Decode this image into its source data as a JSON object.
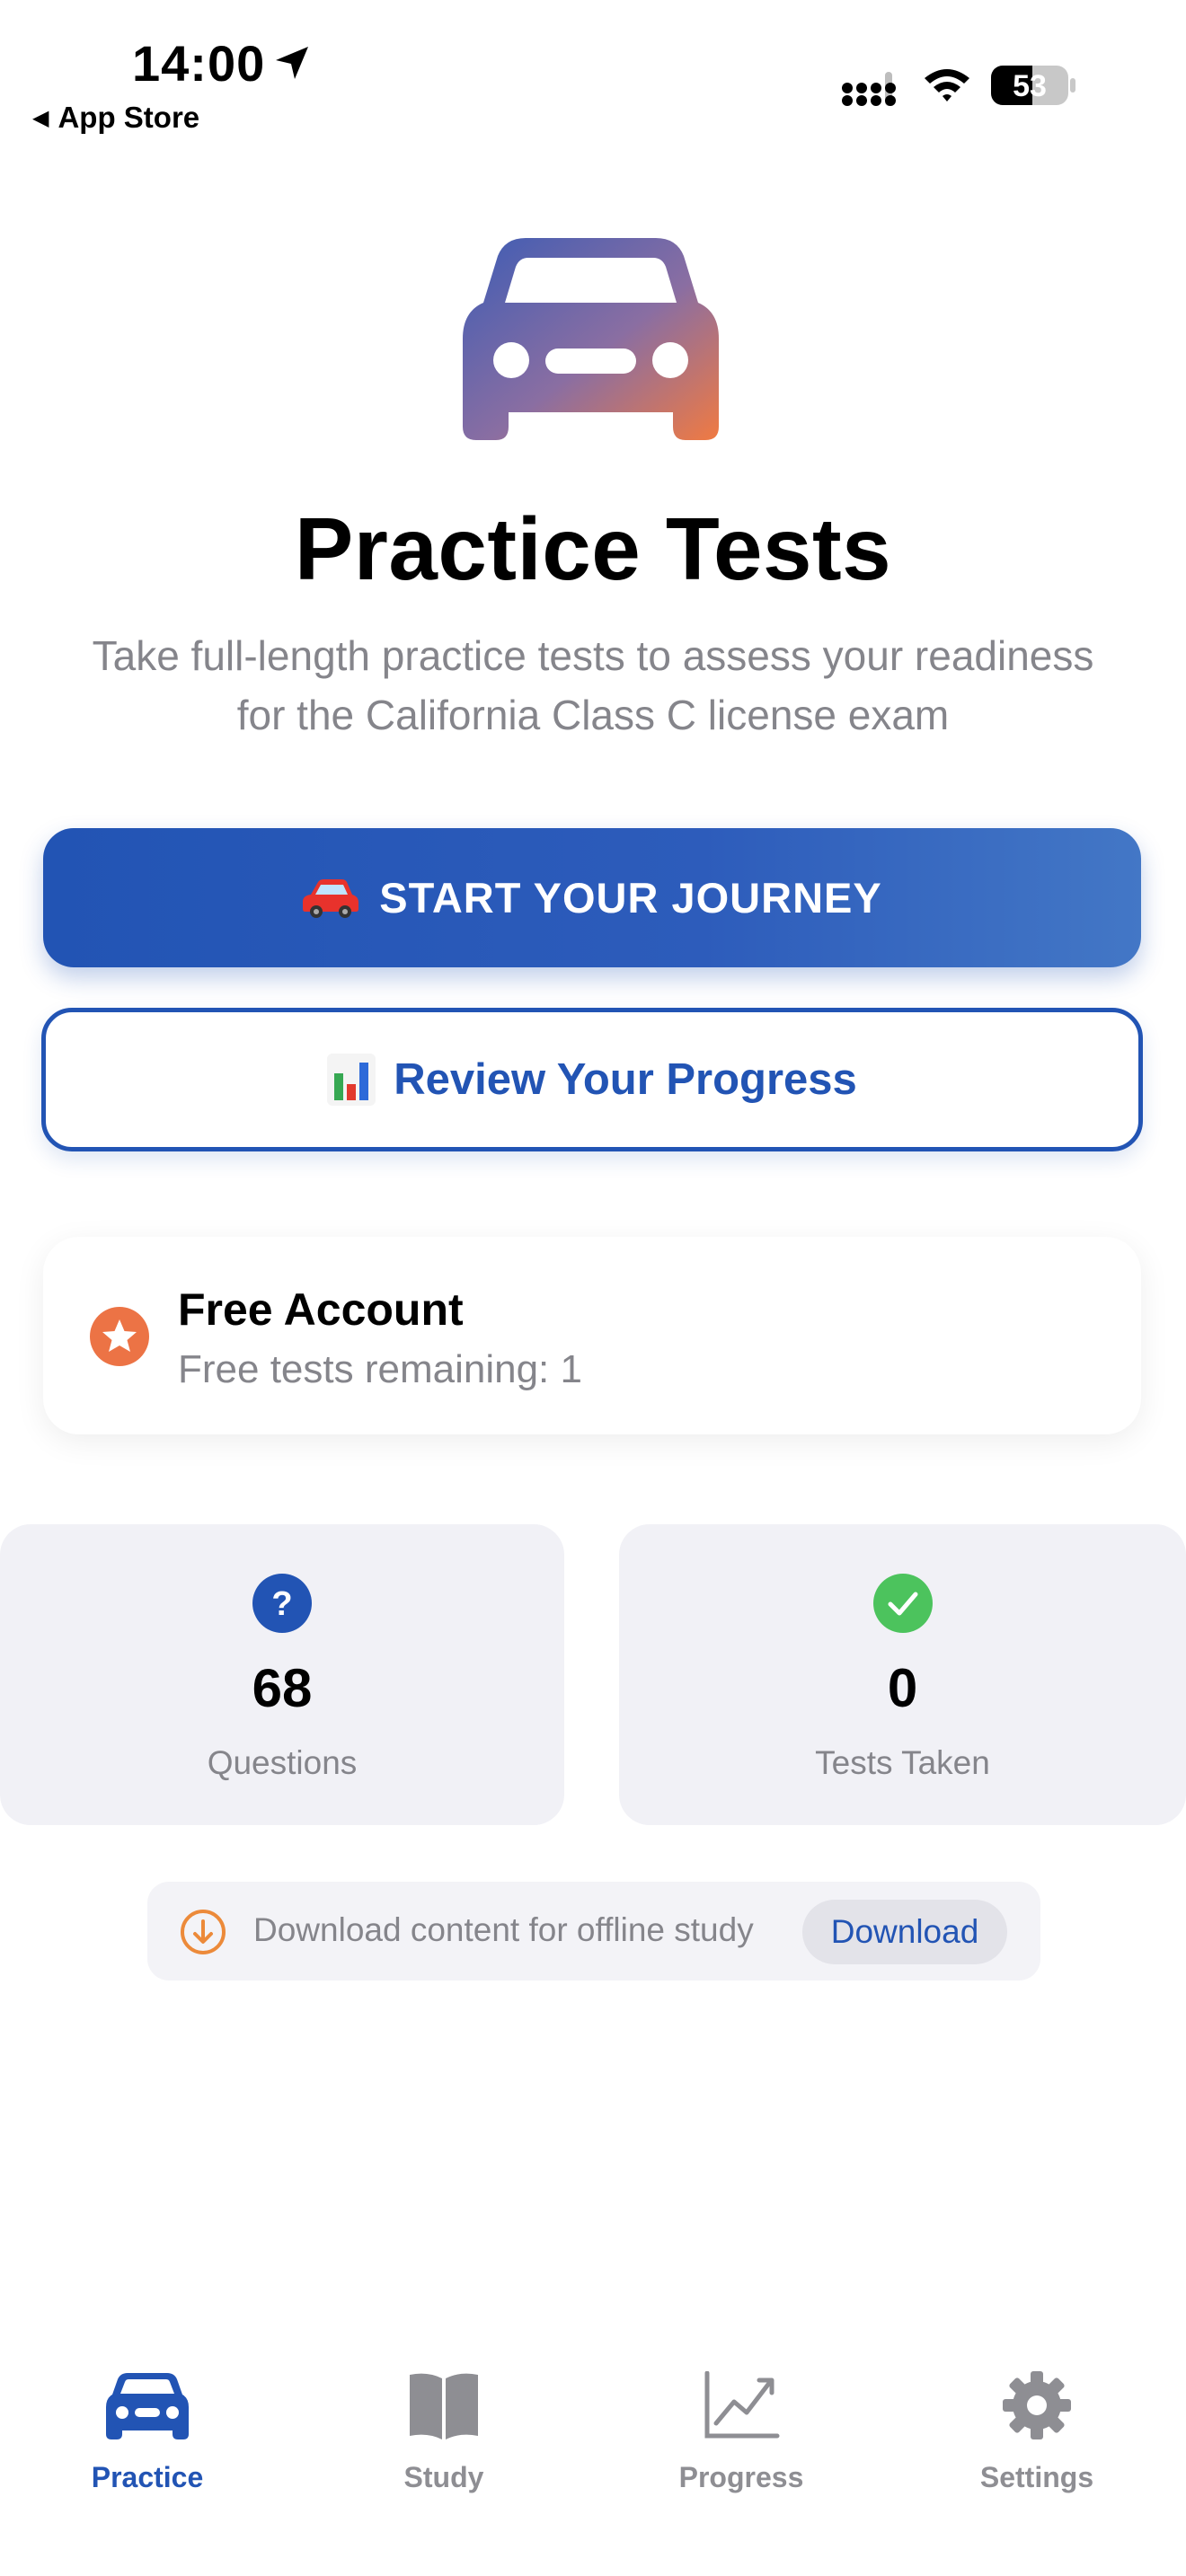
{
  "status_bar": {
    "time": "14:00",
    "back_app": "App Store",
    "battery": "53"
  },
  "hero": {
    "icon": "car-icon",
    "title": "Practice Tests",
    "subtitle": "Take full-length practice tests to assess your readiness for the California Class C license exam"
  },
  "buttons": {
    "primary_label": "START YOUR JOURNEY",
    "secondary_label": "Review Your Progress"
  },
  "account": {
    "title": "Free Account",
    "subtitle": "Free tests remaining: 1"
  },
  "stats": [
    {
      "value": "68",
      "label": "Questions",
      "icon": "question-circle-icon"
    },
    {
      "value": "0",
      "label": "Tests Taken",
      "icon": "checkmark-circle-icon"
    }
  ],
  "offline": {
    "text": "Download content for offline study",
    "button": "Download"
  },
  "tabs": [
    {
      "label": "Practice",
      "icon": "car-icon",
      "active": true
    },
    {
      "label": "Study",
      "icon": "book-icon",
      "active": false
    },
    {
      "label": "Progress",
      "icon": "chart-icon",
      "active": false
    },
    {
      "label": "Settings",
      "icon": "gear-icon",
      "active": false
    }
  ],
  "colors": {
    "accent": "#2254b4",
    "orange": "#ec7345",
    "green": "#4cc35d",
    "gray_text": "#85858b",
    "card_bg": "#f1f1f6"
  }
}
